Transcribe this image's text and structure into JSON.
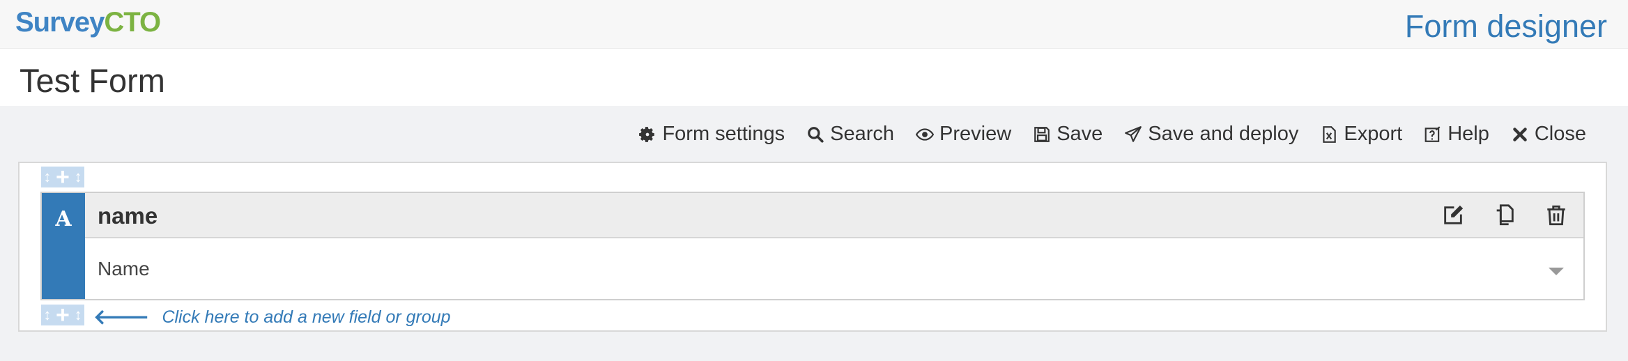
{
  "app": {
    "logo_part1": "Survey",
    "logo_part2": "CTO",
    "page_title": "Form designer"
  },
  "form": {
    "title": "Test Form"
  },
  "toolbar": {
    "settings": "Form settings",
    "search": "Search",
    "preview": "Preview",
    "save": "Save",
    "deploy": "Save and deploy",
    "export": "Export",
    "help": "Help",
    "close": "Close"
  },
  "field": {
    "type_badge": "A",
    "name": "name",
    "label": "Name"
  },
  "add_field": {
    "text": "Click here to add a new field or group"
  },
  "colors": {
    "accent": "#337ab7",
    "logo_green": "#7cb342",
    "handle": "#c6dbf0"
  },
  "icons": [
    "gear-icon",
    "search-icon",
    "eye-icon",
    "floppy-icon",
    "send-icon",
    "excel-icon",
    "help-icon",
    "close-icon",
    "edit-icon",
    "copy-icon",
    "trash-icon",
    "text-type-icon",
    "arrow-left-icon",
    "chevron-down-icon"
  ]
}
